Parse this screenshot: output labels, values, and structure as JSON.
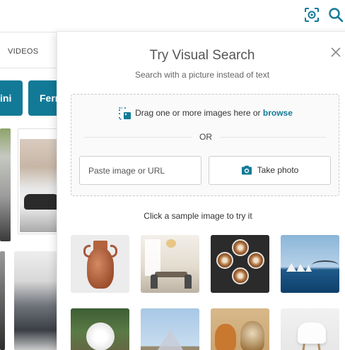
{
  "background_page": {
    "tabs": [
      {
        "label": "VIDEOS"
      }
    ],
    "chips": [
      {
        "label": "ini"
      },
      {
        "label": "Ferra"
      }
    ]
  },
  "header": {
    "icons": [
      "visual-search-icon",
      "search-icon"
    ]
  },
  "visual_search": {
    "title": "Try Visual Search",
    "subtitle": "Search with a picture instead of text",
    "drag_text": "Drag one or more images here or ",
    "browse_label": "browse",
    "or_label": "OR",
    "url_input": {
      "placeholder": "Paste image or URL",
      "value": ""
    },
    "take_photo_label": "Take photo",
    "sample_title": "Click a sample image to try it",
    "samples": [
      {
        "icon": "vase-image"
      },
      {
        "icon": "dining-room-image"
      },
      {
        "icon": "latte-cups-image"
      },
      {
        "icon": "sydney-opera-house-image"
      },
      {
        "icon": "white-rose-image"
      },
      {
        "icon": "louvre-pyramid-image"
      },
      {
        "icon": "dogs-image"
      },
      {
        "icon": "white-chair-image"
      }
    ]
  },
  "colors": {
    "accent": "#127a97",
    "chip_background": "#127a97"
  }
}
